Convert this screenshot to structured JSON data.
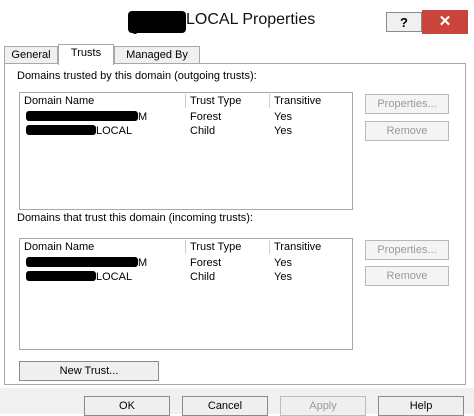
{
  "window": {
    "title": "LOCAL Properties",
    "help_label": "?",
    "close_label": "✕"
  },
  "tabs": [
    {
      "label": "General"
    },
    {
      "label": "Trusts"
    },
    {
      "label": "Managed By"
    }
  ],
  "outgoing": {
    "label": "Domains trusted by this domain (outgoing trusts):",
    "headers": [
      "Domain Name",
      "Trust Type",
      "Transitive"
    ],
    "rows": [
      {
        "name_suffix": "M",
        "type": "Forest",
        "transitive": "Yes"
      },
      {
        "name_suffix": "LOCAL",
        "type": "Child",
        "transitive": "Yes"
      }
    ],
    "properties_label": "Properties...",
    "remove_label": "Remove"
  },
  "incoming": {
    "label": "Domains that trust this domain (incoming trusts):",
    "headers": [
      "Domain Name",
      "Trust Type",
      "Transitive"
    ],
    "rows": [
      {
        "name_suffix": "M",
        "type": "Forest",
        "transitive": "Yes"
      },
      {
        "name_suffix": "LOCAL",
        "type": "Child",
        "transitive": "Yes"
      }
    ],
    "properties_label": "Properties...",
    "remove_label": "Remove"
  },
  "new_trust_label": "New Trust...",
  "footer": {
    "ok_label": "OK",
    "cancel_label": "Cancel",
    "apply_label": "Apply",
    "help_label": "Help"
  },
  "colors": {
    "close_button": "#c9453b",
    "disabled_text": "#9a9a9a",
    "border": "#a8a8a8"
  }
}
